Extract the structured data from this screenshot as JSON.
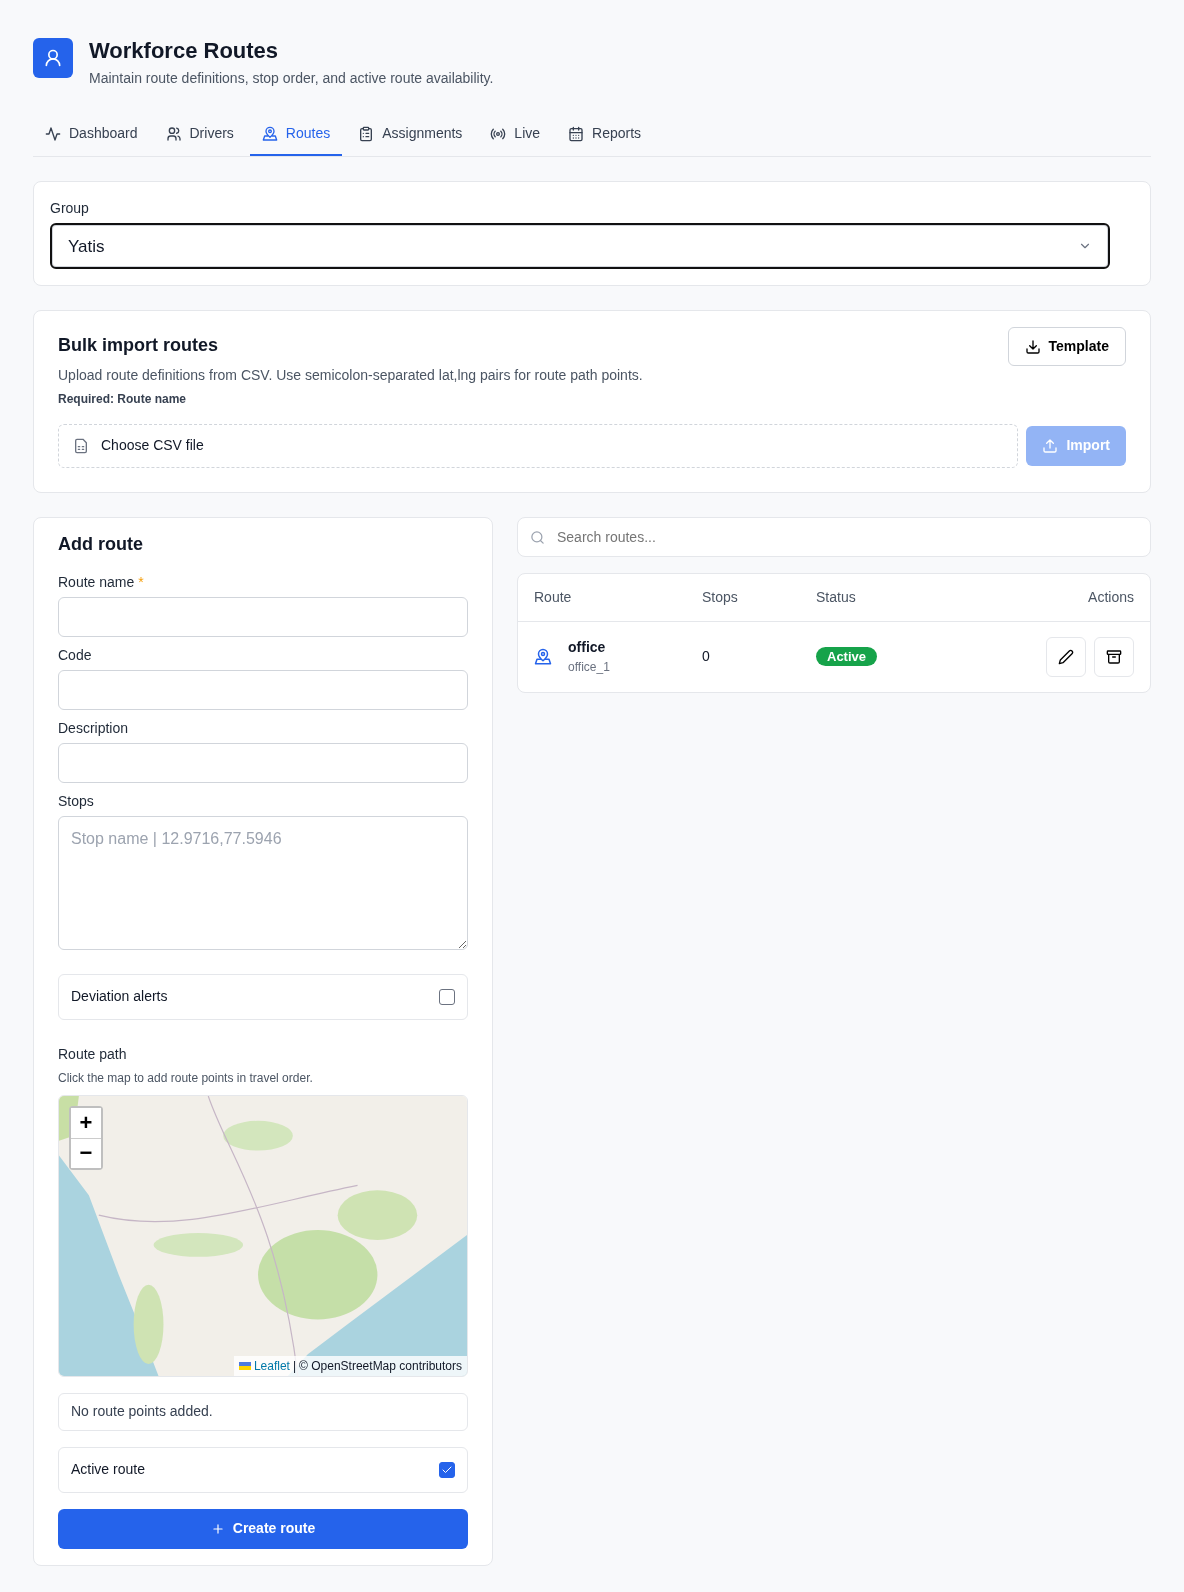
{
  "header": {
    "title": "Workforce Routes",
    "subtitle": "Maintain route definitions, stop order, and active route availability."
  },
  "tabs": [
    {
      "kind": "pulse",
      "label": "Dashboard",
      "selected": false
    },
    {
      "kind": "users",
      "label": "Drivers",
      "selected": false
    },
    {
      "kind": "pin",
      "label": "Routes",
      "selected": true
    },
    {
      "kind": "clipboard",
      "label": "Assignments",
      "selected": false
    },
    {
      "kind": "signal",
      "label": "Live",
      "selected": false
    },
    {
      "kind": "calendar",
      "label": "Reports",
      "selected": false
    }
  ],
  "group": {
    "label": "Group",
    "value": "Yatis"
  },
  "bulk_import": {
    "title": "Bulk import routes",
    "description": "Upload route definitions from CSV. Use semicolon-separated lat,lng pairs for route path points.",
    "required": "Required: Route name",
    "template_button": "Template",
    "file_placeholder": "Choose CSV file",
    "import_button": {
      "label": "Import",
      "disabled": true
    }
  },
  "add_route": {
    "title": "Add route",
    "fields": [
      {
        "kind": "input",
        "label": "Route name",
        "required_mark": "*"
      },
      {
        "kind": "input",
        "label": "Code"
      },
      {
        "kind": "input",
        "label": "Description"
      },
      {
        "kind": "textarea",
        "label": "Stops",
        "placeholder": "Stop name | 12.9716,77.5946"
      }
    ],
    "deviation_alerts": {
      "label": "Deviation alerts",
      "checked": false
    },
    "route_path": {
      "label": "Route path",
      "hint": "Click the map to add route points in travel order."
    },
    "map": {
      "zoom_in": "+",
      "zoom_out": "−",
      "attribution_link": "Leaflet",
      "separator": "|",
      "attribution": "© OpenStreetMap contributors"
    },
    "route_points_note": "No route points added.",
    "active_route": {
      "label": "Active route",
      "checked": true
    },
    "create_button": "Create route"
  },
  "routes": {
    "search_placeholder": "Search routes...",
    "columns": [
      "Route",
      "Stops",
      "Status",
      "Actions"
    ],
    "rows": [
      {
        "name": "office",
        "code": "office_1",
        "stops": "0",
        "status": "Active",
        "active": true
      }
    ]
  }
}
